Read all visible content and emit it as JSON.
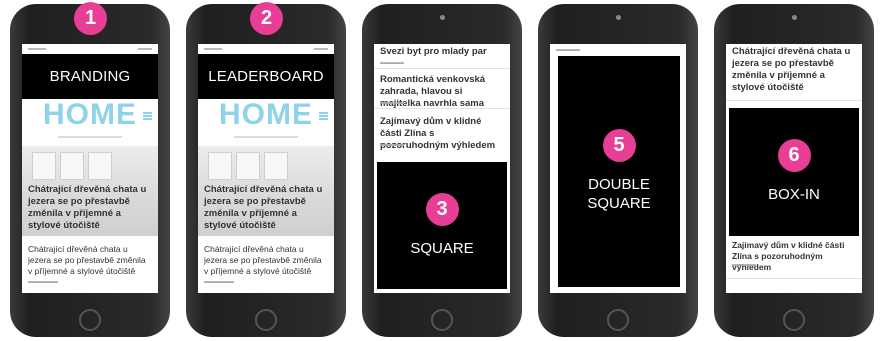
{
  "phones": [
    {
      "number": "1",
      "label": "BRANDING",
      "logo": "HOME",
      "headline": "Chátrající dřevěná chata u jezera se po přestavbě změnila v příjemné a stylové útočiště",
      "para": "Chátrající dřevěná chata u jezera se po přestavbě změnila v příjemné a stylové útočiště"
    },
    {
      "number": "2",
      "label": "LEADERBOARD",
      "logo": "HOME",
      "headline": "Chátrající dřevěná chata u jezera se po přestavbě změnila v příjemné a stylové útočiště",
      "para": "Chátrající dřevěná chata u jezera se po přestavbě změnila v příjemné a stylové útočiště"
    },
    {
      "number": "3",
      "label": "SQUARE",
      "items": [
        "Svezi byt pro mlady par",
        "Romantická venkovská zahrada, hlavou si majitelka navrhla sama",
        "Zajímavý dům v klidné části Zlína s pozoruhodným výhledem"
      ]
    },
    {
      "number": "5",
      "label": "DOUBLE SQUARE"
    },
    {
      "number": "6",
      "label": "BOX-IN",
      "headline": "Chátrající dřevěná chata u jezera se po přestavbě změnila v příjemné a stylové útočiště",
      "para": "Zajímavý dům v klidné části Zlína s pozoruhodným výhledem"
    }
  ]
}
